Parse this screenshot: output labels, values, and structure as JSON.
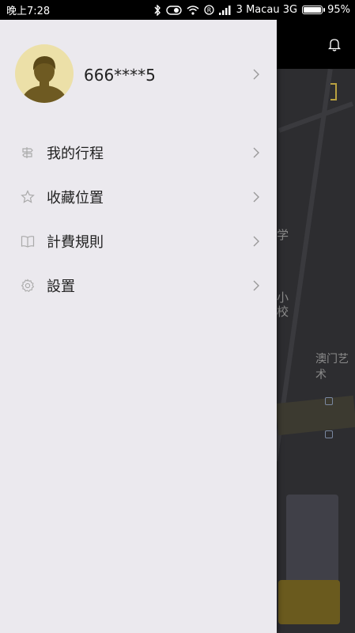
{
  "status_bar": {
    "time": "晚上7:28",
    "carrier": "3 Macau 3G",
    "battery": "95%",
    "battery_level": 0.95
  },
  "drawer": {
    "user": {
      "name": "666****5"
    },
    "menu": [
      {
        "label": "我的行程",
        "icon": "signpost-icon"
      },
      {
        "label": "收藏位置",
        "icon": "star-icon"
      },
      {
        "label": "計費規則",
        "icon": "book-icon"
      },
      {
        "label": "設置",
        "icon": "gear-icon"
      }
    ]
  },
  "map": {
    "labels": [
      "学",
      "小",
      "校",
      "澳门艺术"
    ]
  },
  "colors": {
    "drawer_bg": "#ebe9ee",
    "avatar_bg": "#ece0a8",
    "avatar_fg": "#6e5a22",
    "accent": "#b8a040"
  }
}
